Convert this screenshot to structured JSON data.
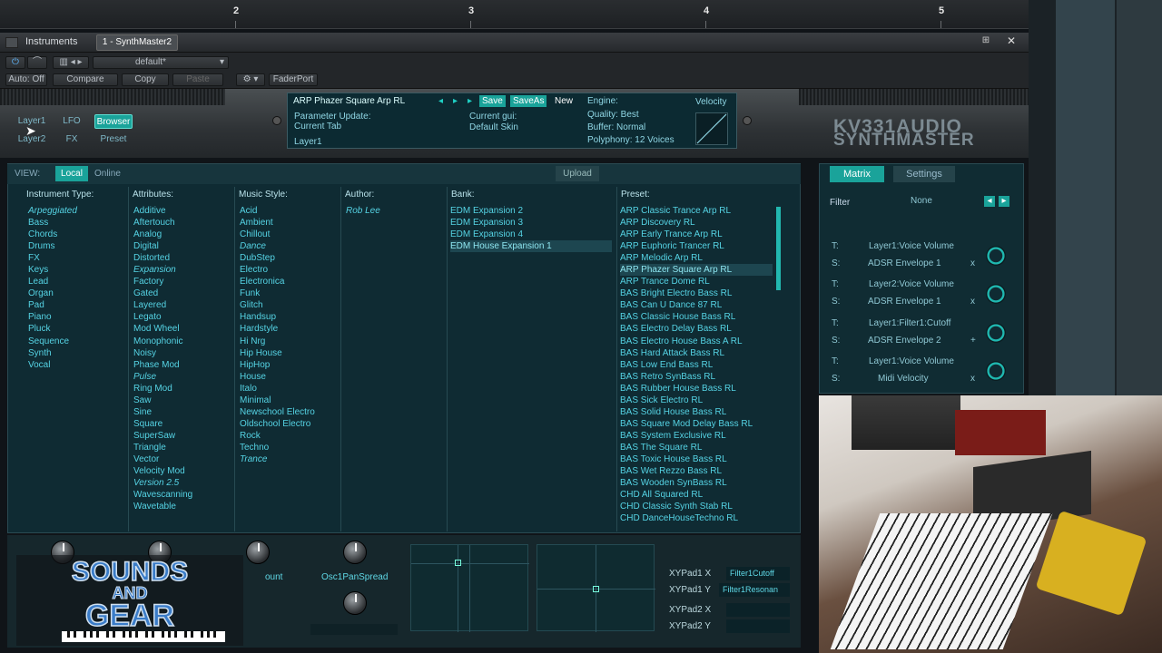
{
  "ruler": {
    "marks": [
      "2",
      "3",
      "4",
      "5"
    ]
  },
  "window": {
    "tab_instruments": "Instruments",
    "tab_plugin": "1 - SynthMaster2",
    "preset_dropdown": "default*",
    "auto_off": "Auto: Off",
    "compare": "Compare",
    "copy": "Copy",
    "paste": "Paste",
    "faderport": "FaderPort"
  },
  "nav": {
    "layer1": "Layer1",
    "layer2": "Layer2",
    "lfo": "LFO",
    "fx": "FX",
    "browser": "Browser",
    "preset": "Preset"
  },
  "display": {
    "preset_name": "ARP Phazer Square Arp  RL",
    "save": "Save",
    "saveas": "SaveAs",
    "new": "New",
    "param_update": "Parameter Update:",
    "current_tab": "Current Tab",
    "current_gui": "Current gui:",
    "default_skin": "Default Skin",
    "layer": "Layer1",
    "engine": "Engine:",
    "quality": "Quality: Best",
    "buffer": "Buffer:   Normal",
    "polyphony": "Polyphony: 12 Voices",
    "velocity": "Velocity"
  },
  "logo": {
    "line1": "KV331AUDIO",
    "line2": "SYNTHMASTER"
  },
  "view_bar": {
    "view": "VIEW:",
    "local": "Local",
    "online": "Online",
    "upload": "Upload"
  },
  "columns": {
    "instrument_type": {
      "header": "Instrument Type:",
      "items": [
        "Arpeggiated",
        "Bass",
        "Chords",
        "Drums",
        "FX",
        "Keys",
        "Lead",
        "Organ",
        "Pad",
        "Piano",
        "Pluck",
        "Sequence",
        "Synth",
        "Vocal"
      ]
    },
    "attributes": {
      "header": "Attributes:",
      "items": [
        "Additive",
        "Aftertouch",
        "Analog",
        "Digital",
        "Distorted",
        "Expansion",
        "Factory",
        "Gated",
        "Layered",
        "Legato",
        "Mod Wheel",
        "Monophonic",
        "Noisy",
        "Phase Mod",
        "Pulse",
        "Ring Mod",
        "Saw",
        "Sine",
        "Square",
        "SuperSaw",
        "Triangle",
        "Vector",
        "Velocity Mod",
        "Version 2.5",
        "Wavescanning",
        "Wavetable"
      ]
    },
    "music_style": {
      "header": "Music Style:",
      "items": [
        "Acid",
        "Ambient",
        "Chillout",
        "Dance",
        "DubStep",
        "Electro",
        "Electronica",
        "Funk",
        "Glitch",
        "Handsup",
        "Hardstyle",
        "Hi Nrg",
        "Hip House",
        "HipHop",
        "House",
        "Italo",
        "Minimal",
        "Newschool Electro",
        "Oldschool Electro",
        "Rock",
        "Techno",
        "Trance"
      ]
    },
    "author": {
      "header": "Author:",
      "items": [
        "Rob Lee"
      ]
    },
    "bank": {
      "header": "Bank:",
      "items": [
        "EDM Expansion 2",
        "EDM Expansion 3",
        "EDM Expansion 4",
        "EDM House Expansion 1"
      ]
    },
    "preset": {
      "header": "Preset:",
      "items": [
        "ARP Classic Trance Arp  RL",
        "ARP Discovery  RL",
        "ARP Early Trance Arp  RL",
        "ARP Euphoric Trancer  RL",
        "ARP Melodic Arp  RL",
        "ARP Phazer Square Arp  RL",
        "ARP Trance Dome  RL",
        "BAS Bright Electro Bass  RL",
        "BAS Can U Dance 87  RL",
        "BAS Classic House Bass  RL",
        "BAS Electro Delay Bass  RL",
        "BAS Electro House Bass A  RL",
        "BAS Hard Attack Bass  RL",
        "BAS Low End Bass  RL",
        "BAS Retro SynBass  RL",
        "BAS Rubber House Bass  RL",
        "BAS Sick Electro  RL",
        "BAS Solid House Bass  RL",
        "BAS Square Mod Delay Bass  RL",
        "BAS System Exclusive  RL",
        "BAS The Square  RL",
        "BAS Toxic House Bass  RL",
        "BAS Wet Rezzo Bass  RL",
        "BAS Wooden SynBass  RL",
        "CHD All Squared  RL",
        "CHD Classic Synth Stab  RL",
        "CHD DanceHouseTechno  RL"
      ]
    }
  },
  "bottom": {
    "knob_label_1": "ount",
    "knob_label_2": "Osc1PanSpread",
    "xy1x": "XYPad1 X",
    "xy1y": "XYPad1 Y",
    "xy2x": "XYPad2 X",
    "xy2y": "XYPad2 Y",
    "xy1x_val": "Filter1Cutoff",
    "xy1y_val": "Filter1Resonan"
  },
  "matrix": {
    "tab_matrix": "Matrix",
    "tab_settings": "Settings",
    "filter": "Filter",
    "filter_val": "None",
    "rows": [
      {
        "t": "T:",
        "target": "Layer1:Voice Volume",
        "s": "S:",
        "source": "ADSR Envelope 1",
        "op": "x"
      },
      {
        "t": "T:",
        "target": "Layer2:Voice Volume",
        "s": "S:",
        "source": "ADSR Envelope 1",
        "op": "x"
      },
      {
        "t": "T:",
        "target": "Layer1:Filter1:Cutoff",
        "s": "S:",
        "source": "ADSR Envelope 2",
        "op": "+"
      },
      {
        "t": "T:",
        "target": "Layer1:Voice Volume",
        "s": "S:",
        "source": "Midi Velocity",
        "op": "x"
      }
    ]
  },
  "watermark": {
    "line1": "SOUNDS",
    "line2": "AND",
    "line3": "GEAR"
  },
  "colors": {
    "accent": "#1aa39a",
    "list_text": "#55d3e4",
    "panel": "#0f2b33"
  }
}
